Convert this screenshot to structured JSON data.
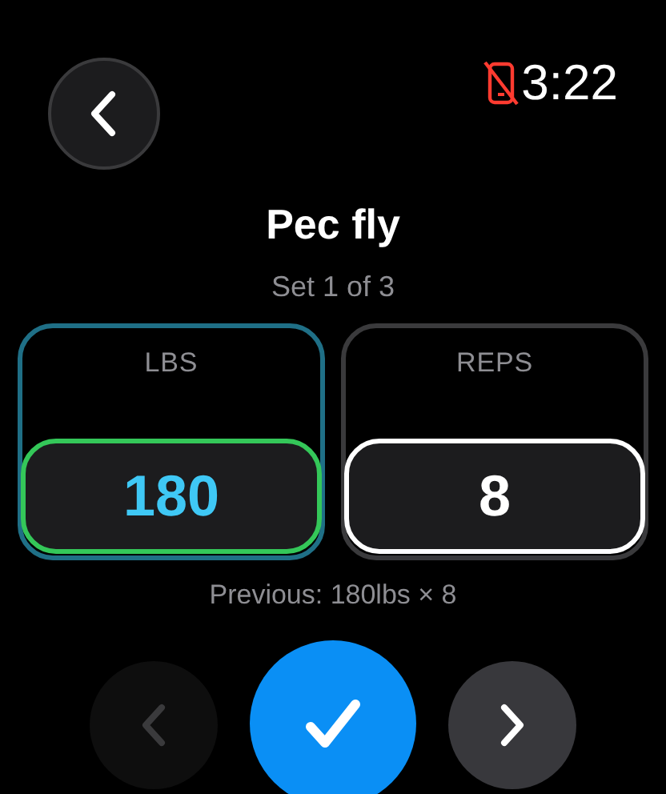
{
  "status": {
    "phone_disconnected": true,
    "time": "3:22"
  },
  "title": "Pec fly",
  "subtitle": "Set 1 of 3",
  "fields": [
    {
      "label": "LBS",
      "value": "180",
      "selected": true
    },
    {
      "label": "REPS",
      "value": "8",
      "selected": false
    }
  ],
  "previous": "Previous: 180lbs × 8",
  "controls": [
    {
      "kind": "previous",
      "disabled": true
    },
    {
      "kind": "complete",
      "disabled": false
    },
    {
      "kind": "next",
      "disabled": false
    }
  ]
}
